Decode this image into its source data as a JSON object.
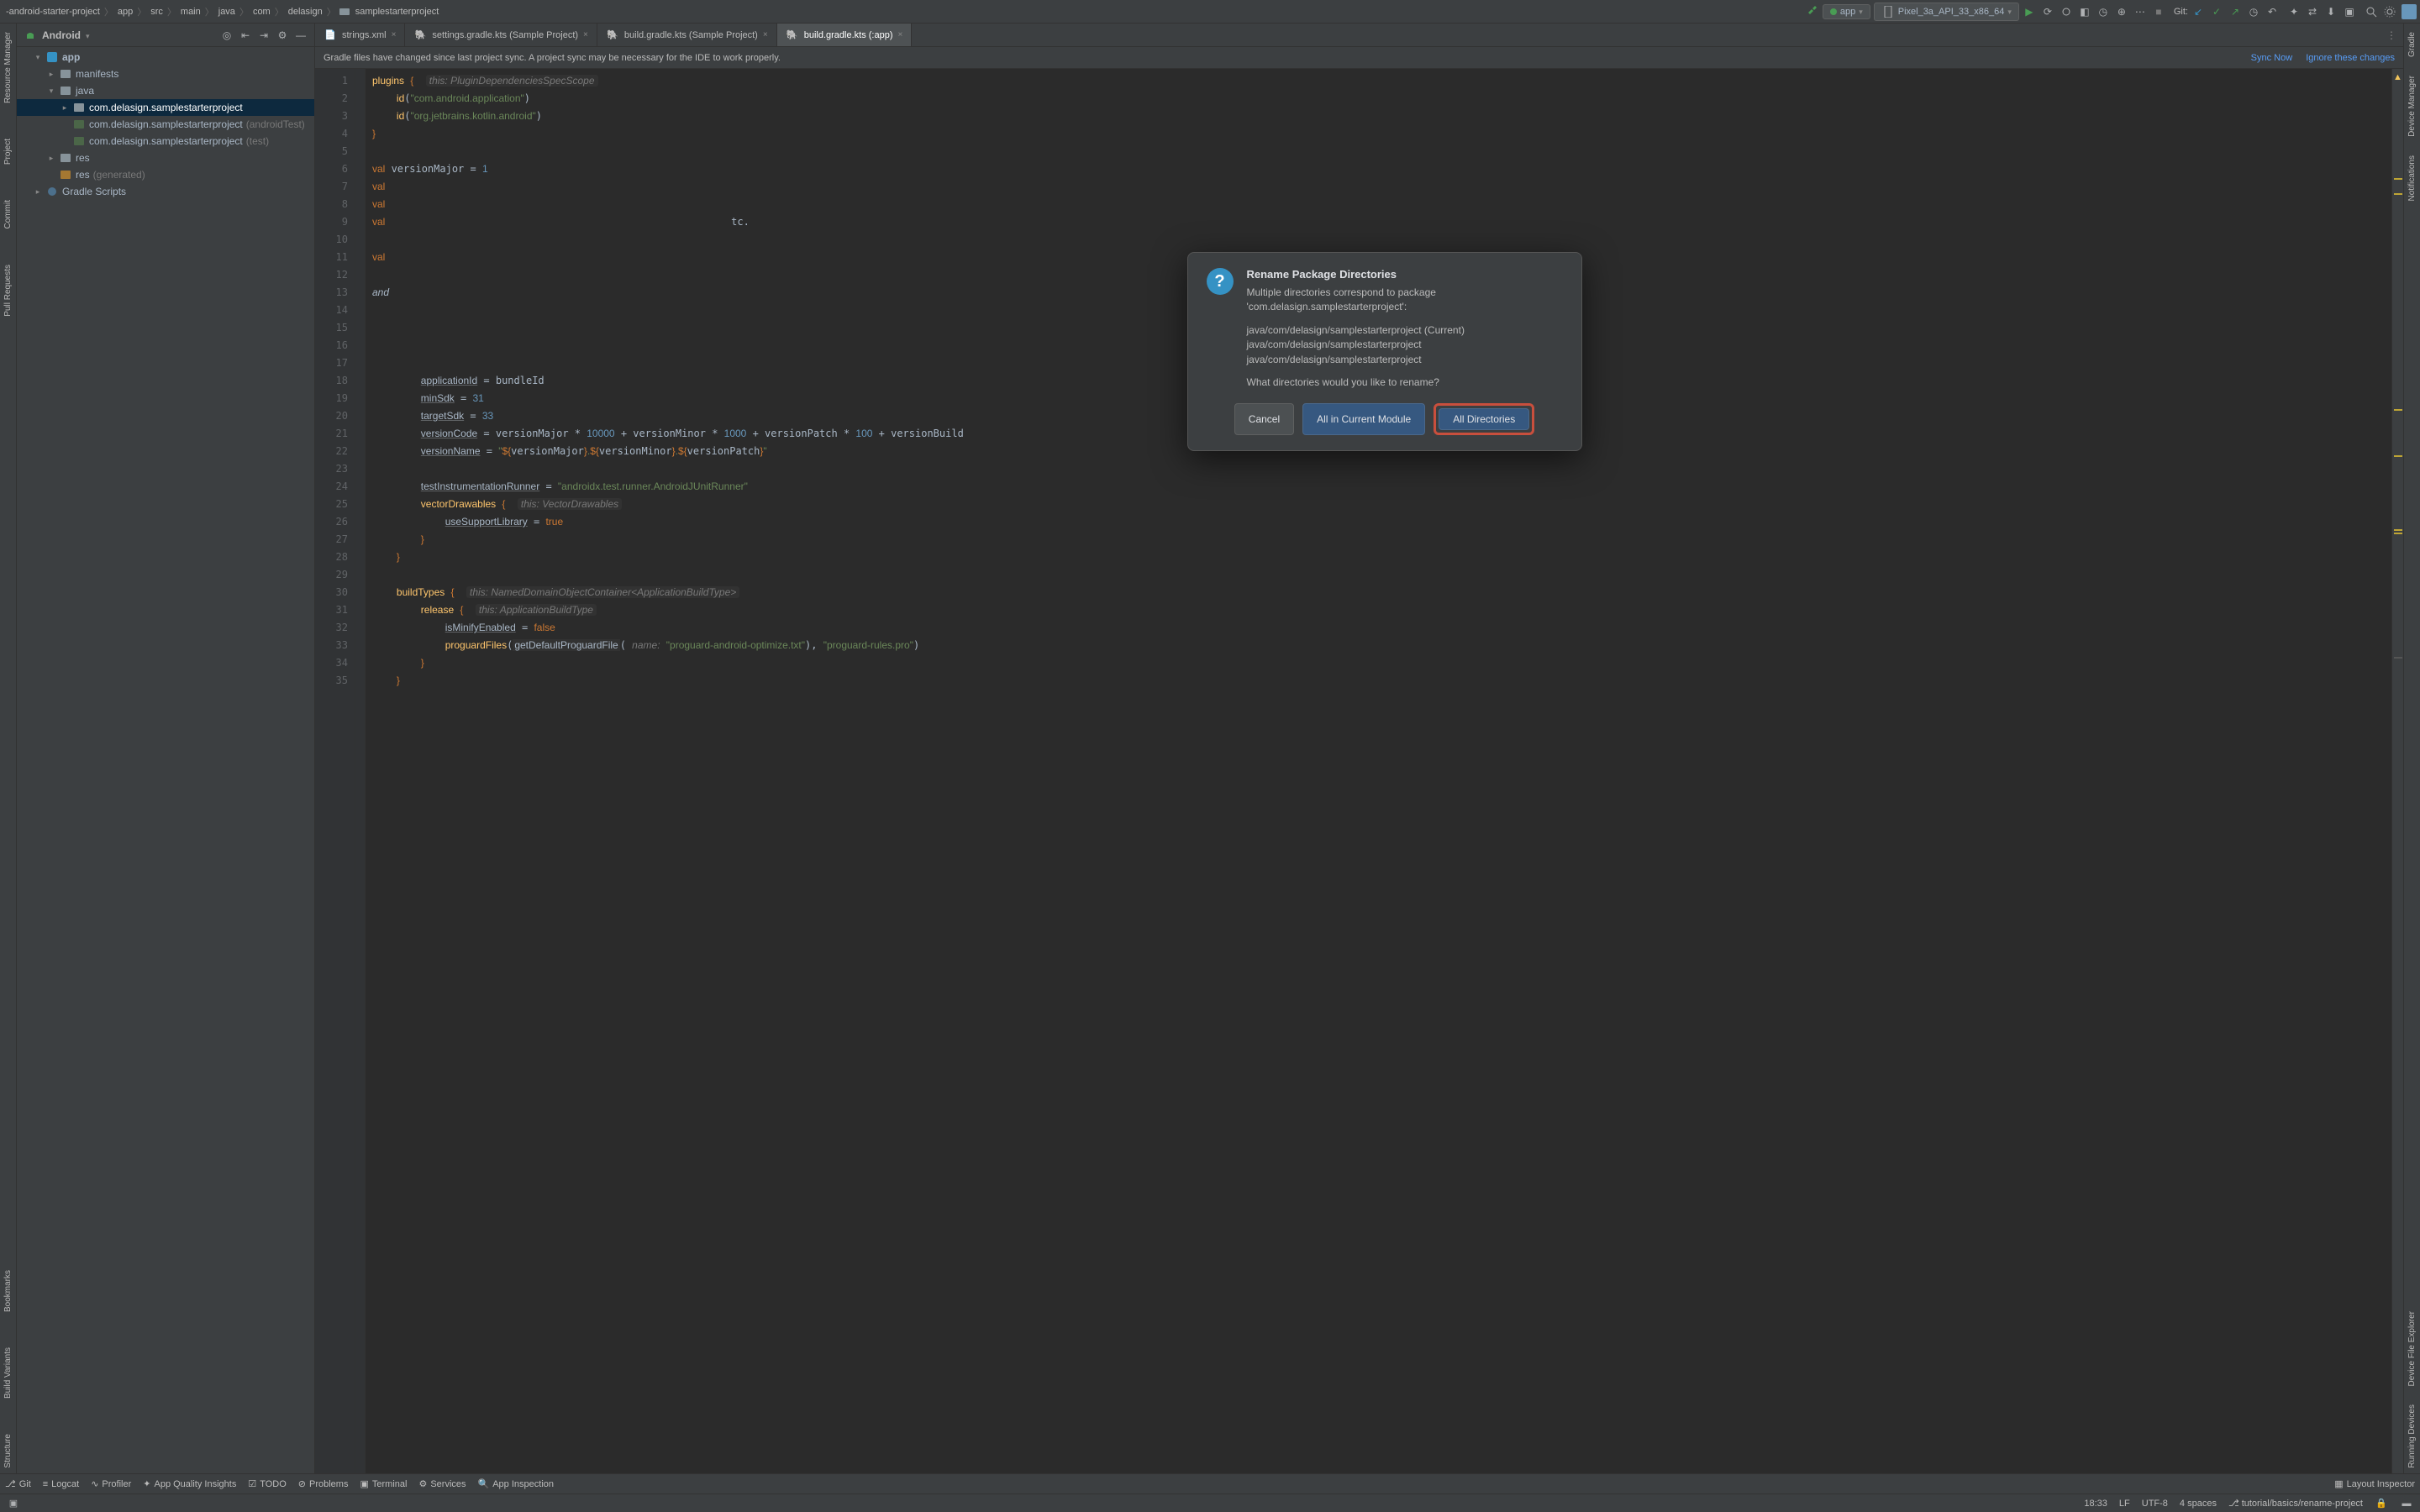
{
  "breadcrumb": [
    "-android-starter-project",
    "app",
    "src",
    "main",
    "java",
    "com",
    "delasign",
    "samplestarterproject"
  ],
  "run_config": {
    "label": "app"
  },
  "device": {
    "label": "Pixel_3a_API_33_x86_64"
  },
  "git_label": "Git:",
  "project_view": {
    "title": "Android"
  },
  "tree": {
    "app": "app",
    "manifests": "manifests",
    "java": "java",
    "pkg": "com.delasign.samplestarterproject",
    "pkg_androidTest": "com.delasign.samplestarterproject",
    "pkg_androidTest_suffix": "(androidTest)",
    "pkg_test": "com.delasign.samplestarterproject",
    "pkg_test_suffix": "(test)",
    "res": "res",
    "res_gen": "res",
    "res_gen_suffix": "(generated)",
    "gradle_scripts": "Gradle Scripts"
  },
  "tabs": [
    {
      "label": "strings.xml"
    },
    {
      "label": "settings.gradle.kts (Sample Project)"
    },
    {
      "label": "build.gradle.kts (Sample Project)"
    },
    {
      "label": "build.gradle.kts (:app)"
    }
  ],
  "sync": {
    "msg": "Gradle files have changed since last project sync. A project sync may be necessary for the IDE to work properly.",
    "sync_now": "Sync Now",
    "ignore": "Ignore these changes"
  },
  "code_lines": [
    "plugins {  ",
    "    id(\"com.android.application\")",
    "    id(\"org.jetbrains.kotlin.android\")",
    "}",
    "",
    "val versionMajor = 1",
    "val",
    "val",
    "val                                                                       tc.",
    "",
    "val",
    "",
    "and",
    "",
    "",
    "",
    "",
    "        applicationId = bundleId",
    "        minSdk = 31",
    "        targetSdk = 33",
    "        versionCode = versionMajor * 10000 + versionMinor * 1000 + versionPatch * 100 + versionBuild",
    "        versionName = \"${versionMajor}.${versionMinor}.${versionPatch}\"",
    "",
    "        testInstrumentationRunner = \"androidx.test.runner.AndroidJUnitRunner\"",
    "        vectorDrawables {  ",
    "            useSupportLibrary = true",
    "        }",
    "    }",
    "",
    "    buildTypes {  ",
    "        release {  ",
    "            isMinifyEnabled = false",
    "            proguardFiles(getDefaultProguardFile( name: \"proguard-android-optimize.txt\"), \"proguard-rules.pro\")",
    "        }",
    "    }"
  ],
  "hints": {
    "plugins": "this: PluginDependenciesSpecScope",
    "vectorDrawables": "this: VectorDrawables",
    "buildTypes": "this: NamedDomainObjectContainer<ApplicationBuildType>",
    "release": "this: ApplicationBuildType",
    "proguard_name": "name:"
  },
  "modal": {
    "title": "Rename Package Directories",
    "line1": "Multiple directories correspond to package",
    "line2": "'com.delasign.samplestarterproject':",
    "dir1": "java/com/delasign/samplestarterproject (Current)",
    "dir2": "java/com/delasign/samplestarterproject",
    "dir3": "java/com/delasign/samplestarterproject",
    "question": "What directories would you like to rename?",
    "cancel": "Cancel",
    "current_module": "All in Current Module",
    "all_dirs": "All Directories"
  },
  "left_rail": [
    "Resource Manager",
    "Project",
    "Commit",
    "Pull Requests",
    "Bookmarks",
    "Build Variants",
    "Structure"
  ],
  "right_rail": [
    "Gradle",
    "Device Manager",
    "Notifications",
    "Device File Explorer",
    "Running Devices"
  ],
  "bottom": {
    "git": "Git",
    "logcat": "Logcat",
    "profiler": "Profiler",
    "quality": "App Quality Insights",
    "todo": "TODO",
    "problems": "Problems",
    "terminal": "Terminal",
    "services": "Services",
    "inspection": "App Inspection",
    "layout_inspector": "Layout Inspector"
  },
  "status": {
    "pos": "18:33",
    "le": "LF",
    "enc": "UTF-8",
    "indent": "4 spaces",
    "branch": "tutorial/basics/rename-project"
  }
}
